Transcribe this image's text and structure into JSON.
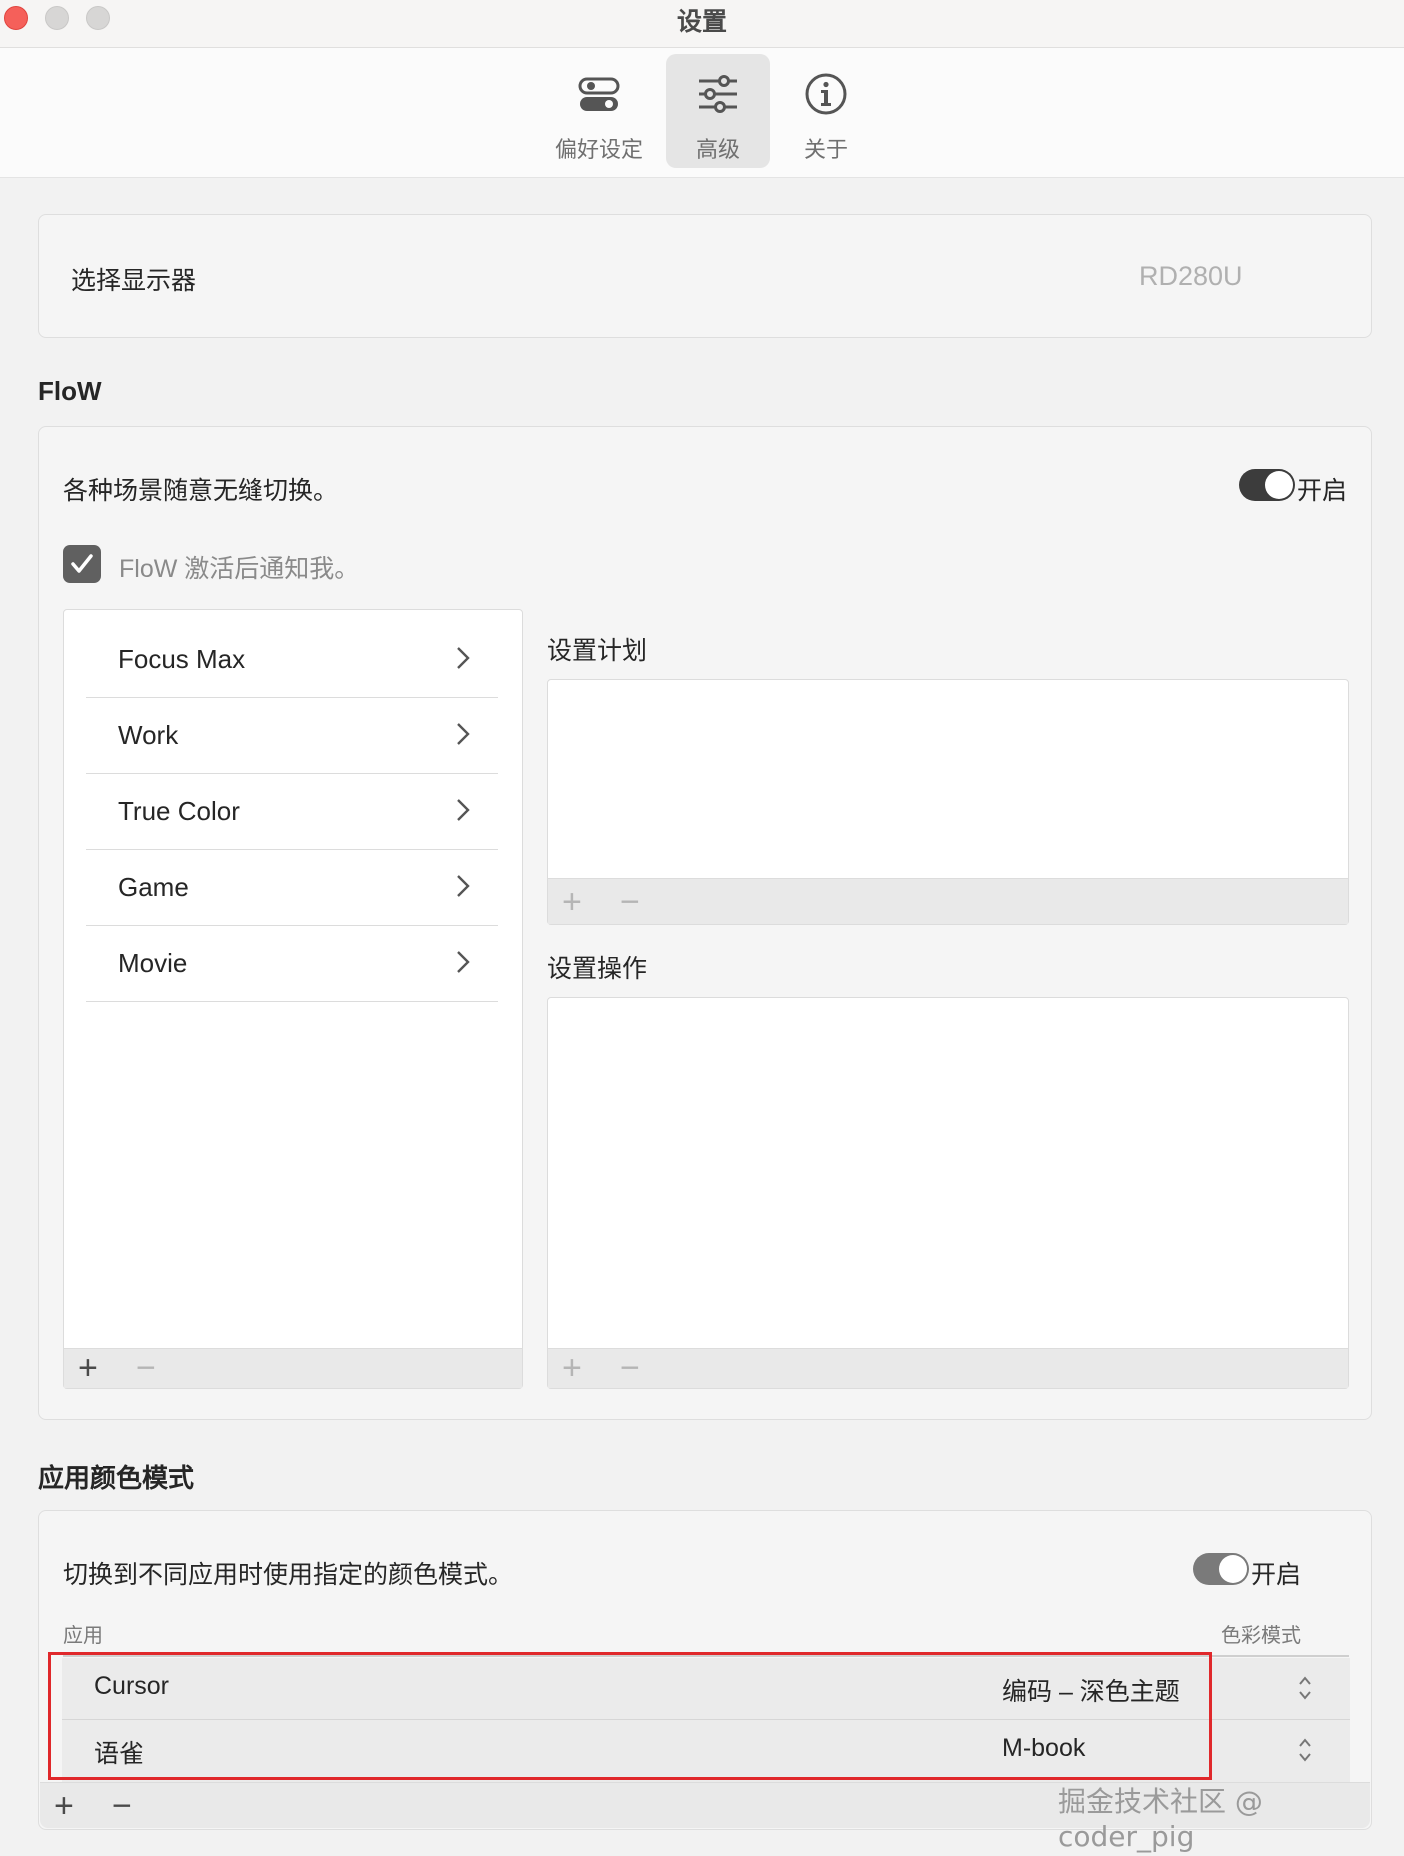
{
  "window": {
    "title": "设置"
  },
  "tabs": [
    {
      "label": "偏好设定",
      "icon": "toggles-icon",
      "active": false
    },
    {
      "label": "高级",
      "icon": "sliders-icon",
      "active": true
    },
    {
      "label": "关于",
      "icon": "info-icon",
      "active": false
    }
  ],
  "display": {
    "label": "选择显示器",
    "value": "RD280U"
  },
  "flow": {
    "title": "FloW",
    "description": "各种场景随意无缝切换。",
    "toggle_label": "开启",
    "toggle_on": true,
    "notify_label": "FloW 激活后通知我。",
    "notify_checked": true,
    "scenes": [
      "Focus Max",
      "Work",
      "True Color",
      "Game",
      "Movie"
    ],
    "plan_title": "设置计划",
    "action_title": "设置操作"
  },
  "color_mode": {
    "title": "应用颜色模式",
    "description": "切换到不同应用时使用指定的颜色模式。",
    "toggle_label": "开启",
    "toggle_on": true,
    "col_app": "应用",
    "col_mode": "色彩模式",
    "rows": [
      {
        "app": "Cursor",
        "mode": "编码 – 深色主题"
      },
      {
        "app": "语雀",
        "mode": "M-book"
      }
    ]
  },
  "controls": {
    "add": "+",
    "remove": "−"
  },
  "watermark": "掘金技术社区 @ coder_pig",
  "colors": {
    "highlight": "#e0282b",
    "toggle_on": "#3c3c3c",
    "close": "#f5605a"
  }
}
